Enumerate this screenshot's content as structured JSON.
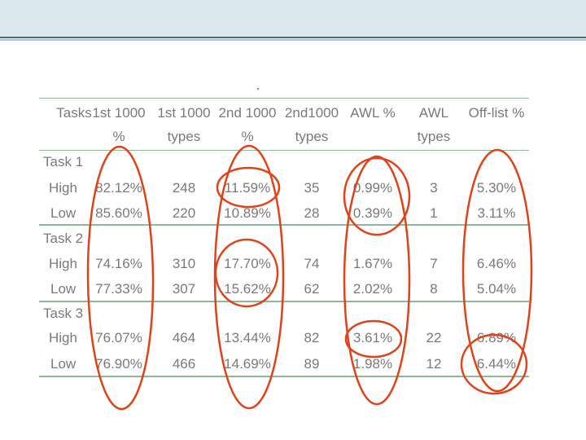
{
  "table": {
    "headers": [
      {
        "line1": "Tasks",
        "line2": ""
      },
      {
        "line1": "1st 1000",
        "line2": "%"
      },
      {
        "line1": "1st 1000",
        "line2": "types"
      },
      {
        "line1": "2nd 1000",
        "line2": "%"
      },
      {
        "line1": "2nd1000",
        "line2": "types"
      },
      {
        "line1": "AWL %",
        "line2": ""
      },
      {
        "line1": "AWL",
        "line2": "types"
      },
      {
        "line1": "Off-list %",
        "line2": ""
      }
    ],
    "groups": [
      {
        "name": "Task 1",
        "rows": [
          {
            "level": "High",
            "v1": "82.12%",
            "v2": "248",
            "v3": "11.59%",
            "v4": "35",
            "v5": "0.99%",
            "v6": "3",
            "v7": "5.30%"
          },
          {
            "level": "Low",
            "v1": "85.60%",
            "v2": "220",
            "v3": "10.89%",
            "v4": "28",
            "v5": "0.39%",
            "v6": "1",
            "v7": "3.11%"
          }
        ]
      },
      {
        "name": "Task 2",
        "rows": [
          {
            "level": "High",
            "v1": "74.16%",
            "v2": "310",
            "v3": "17.70%",
            "v4": "74",
            "v5": "1.67%",
            "v6": "7",
            "v7": "6.46%"
          },
          {
            "level": "Low",
            "v1": "77.33%",
            "v2": "307",
            "v3": "15.62%",
            "v4": "62",
            "v5": "2.02%",
            "v6": "8",
            "v7": "5.04%"
          }
        ]
      },
      {
        "name": "Task 3",
        "rows": [
          {
            "level": "High",
            "v1": "76.07%",
            "v2": "464",
            "v3": "13.44%",
            "v4": "82",
            "v5": "3.61%",
            "v6": "22",
            "v7": "6.89%"
          },
          {
            "level": "Low",
            "v1": "76.90%",
            "v2": "466",
            "v3": "14.69%",
            "v4": "89",
            "v5": "1.98%",
            "v6": "12",
            "v7": "6.44%"
          }
        ]
      }
    ]
  },
  "colors": {
    "annotation": "#e0421a",
    "text": "#7a7a7a",
    "rule": "#8fb89a",
    "header_band": "#dbe9ef"
  }
}
